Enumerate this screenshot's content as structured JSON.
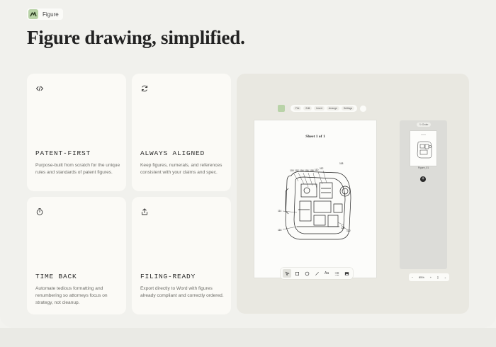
{
  "brand": {
    "name": "Figure"
  },
  "headline": "Figure drawing, simplified.",
  "features": [
    {
      "title": "PATENT-FIRST",
      "icon": "code-icon",
      "body": "Purpose-built from scratch for the unique rules and standards of patent figures."
    },
    {
      "title": "ALWAYS ALIGNED",
      "icon": "refresh-icon",
      "body": "Keep figures, numerals, and references consistent with your claims and spec."
    },
    {
      "title": "TIME BACK",
      "icon": "timer-icon",
      "body": "Automate tedious formatting and renumbering so attorneys focus on strategy, not cleanup."
    },
    {
      "title": "FILING-READY",
      "icon": "share-icon",
      "body": "Export directly to Word with figures already compliant and correctly ordered."
    }
  ],
  "preview": {
    "menu": [
      "File",
      "Edit",
      "Insert",
      "Arrange",
      "Settings"
    ],
    "sheet_title": "Sheet 1 of 1",
    "reference_numerals": [
      "100",
      "102",
      "104",
      "106",
      "108",
      "110",
      "112",
      "114",
      "116",
      "118",
      "120",
      "122",
      "124",
      "126",
      "128",
      "130",
      "132"
    ],
    "panel_header": "Order",
    "thumb_label": "Figure_01",
    "zoom_level": "85%",
    "tools": [
      "select-tool",
      "rectangle-tool",
      "circle-tool",
      "line-tool",
      "Aa",
      "numbered-list-tool",
      "image-tool"
    ]
  }
}
